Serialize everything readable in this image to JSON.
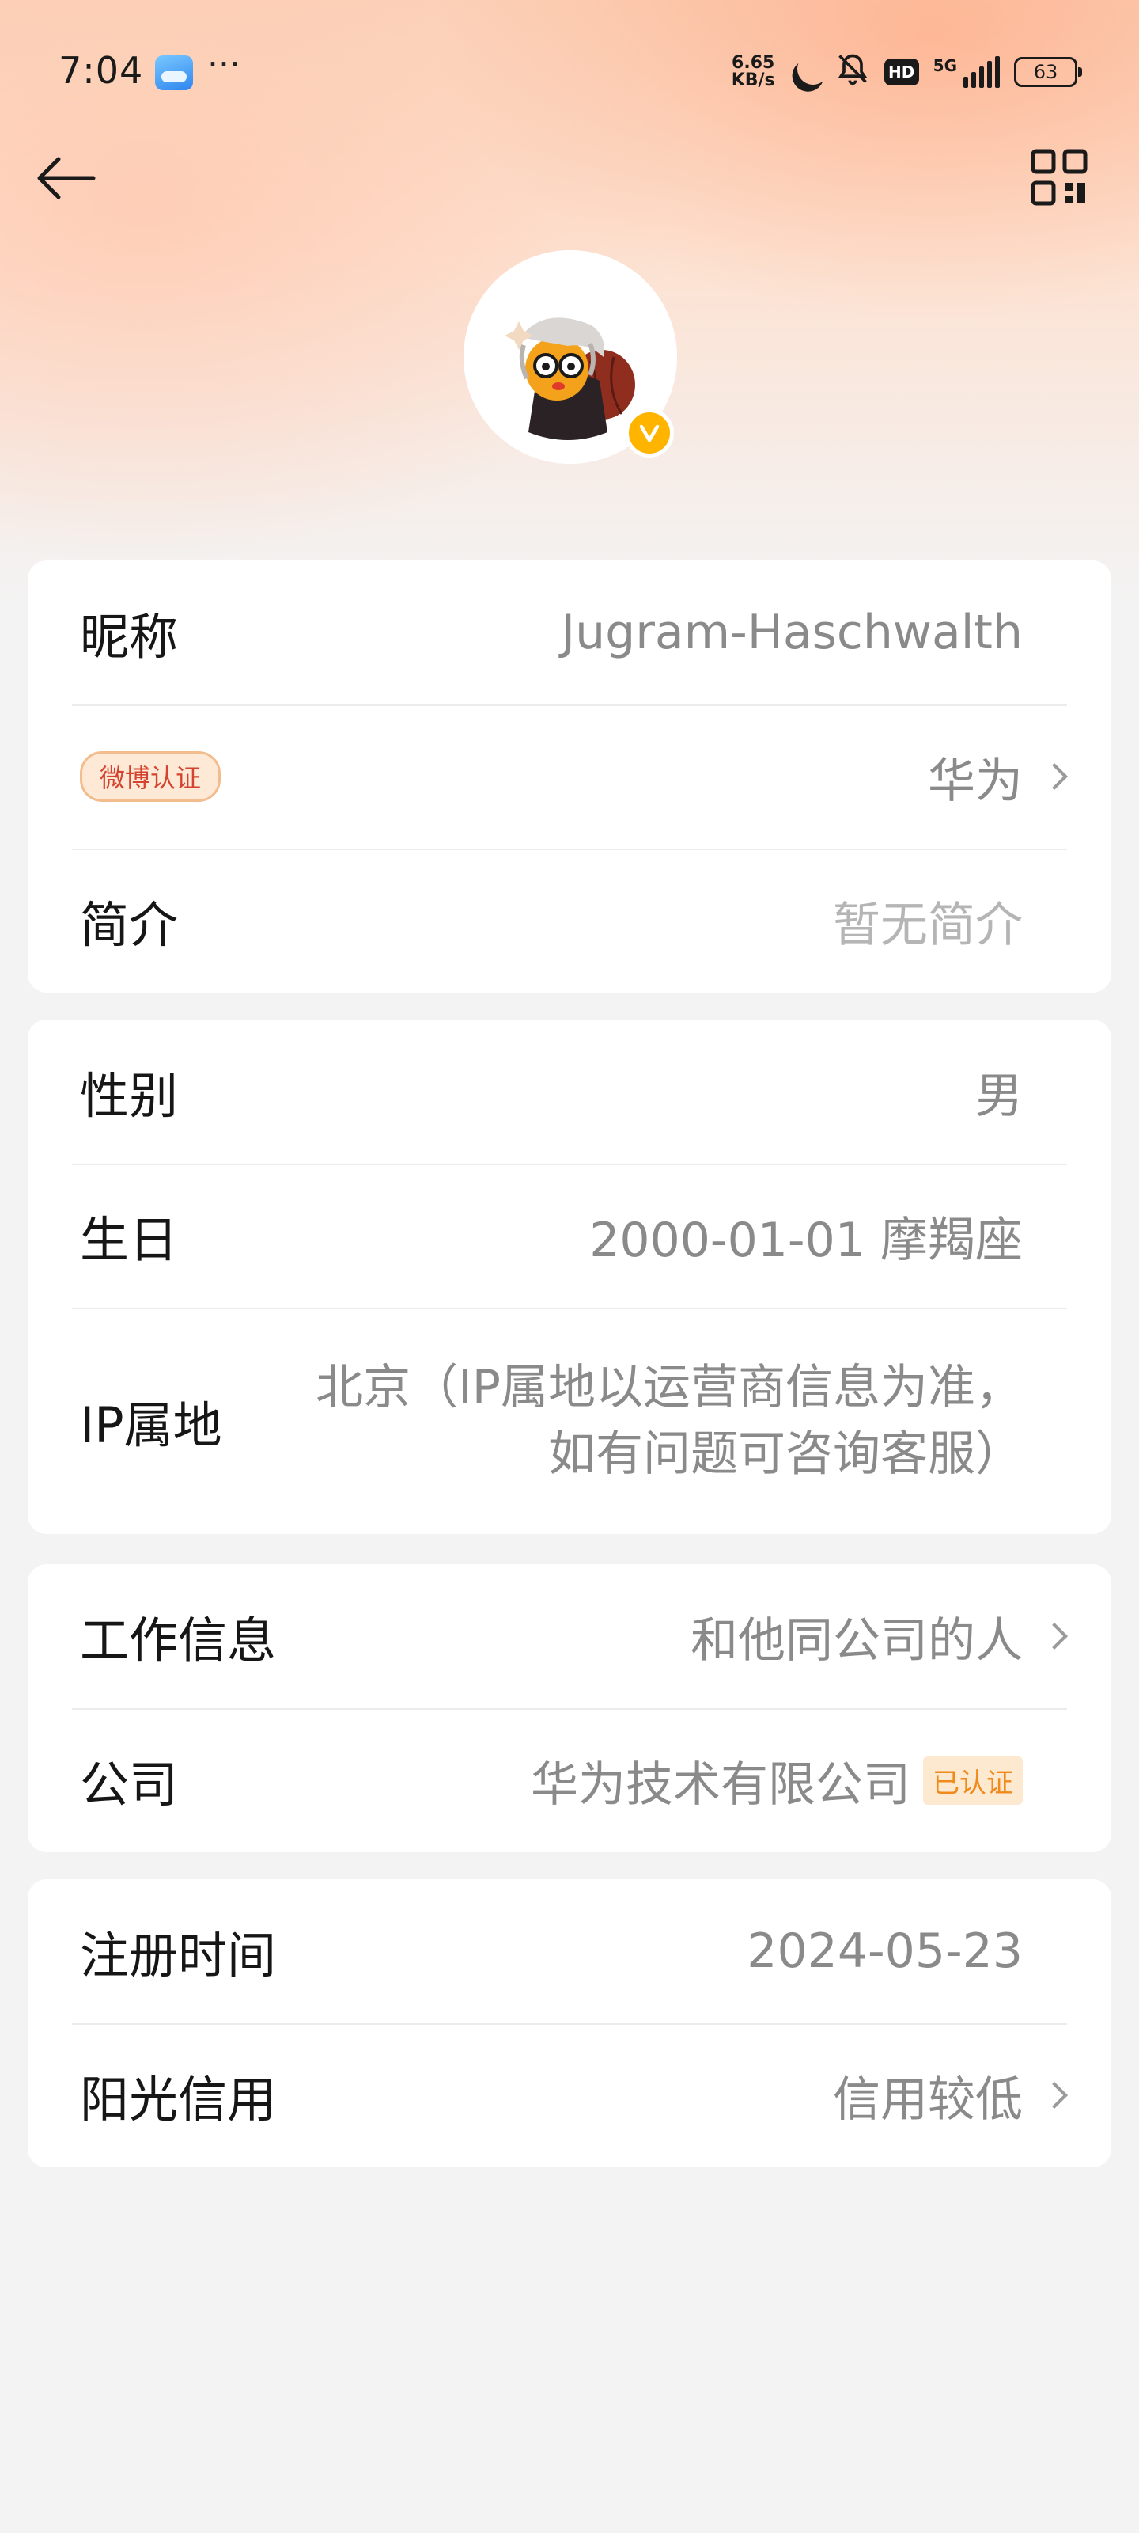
{
  "status_bar": {
    "time": "7:04",
    "net_speed_value": "6.65",
    "net_speed_unit": "KB/s",
    "network": "5G",
    "battery": "63"
  },
  "profile": {
    "nickname_label": "昵称",
    "nickname_value": "Jugram-Haschwalth",
    "weibo_tag": "微博认证",
    "weibo_value": "华为",
    "bio_label": "简介",
    "bio_value": "暂无简介"
  },
  "personal": {
    "gender_label": "性别",
    "gender_value": "男",
    "birthday_label": "生日",
    "birthday_value": "2000-01-01 摩羯座",
    "ip_label": "IP属地",
    "ip_value": "北京（IP属地以运营商信息为准，如有问题可咨询客服）"
  },
  "work": {
    "work_label": "工作信息",
    "work_value": "和他同公司的人",
    "company_label": "公司",
    "company_value": "华为技术有限公司",
    "company_tag": "已认证"
  },
  "account": {
    "register_label": "注册时间",
    "register_value": "2024-05-23",
    "credit_label": "阳光信用",
    "credit_value": "信用较低"
  },
  "icons": [
    "weather-icon",
    "more-icon",
    "moon-icon",
    "bell-off-icon",
    "hd-icon",
    "signal-icon",
    "battery-icon",
    "back-arrow-icon",
    "qr-code-icon",
    "verified-v-icon",
    "chevron-right-icon"
  ],
  "colors": {
    "verified_badge": "#ffb400",
    "weibo_tag_text": "#d4432f",
    "company_tag_text": "#f08a1c",
    "header_gradient": "#fbd2b9"
  }
}
